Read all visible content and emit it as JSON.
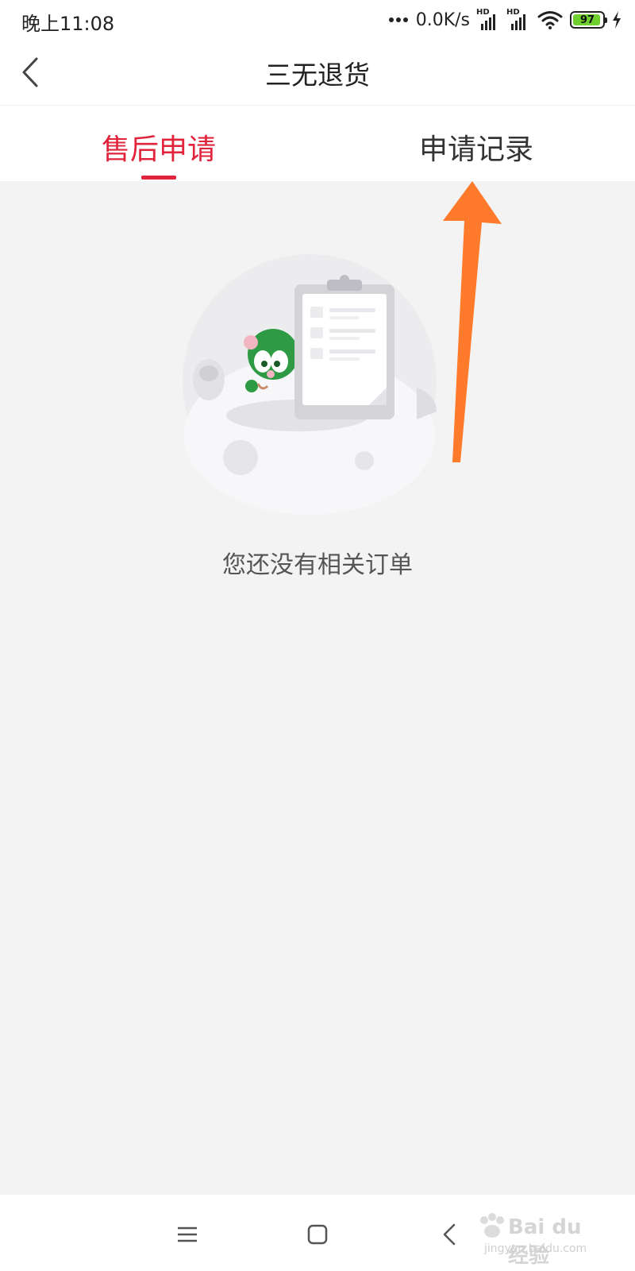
{
  "status_bar": {
    "time": "晚上11:08",
    "network_speed": "0.0K/s",
    "signal_label_1": "HD",
    "signal_label_2": "HD",
    "battery_level": "97"
  },
  "header": {
    "title": "三无退货"
  },
  "tabs": [
    {
      "label": "售后申请",
      "active": true
    },
    {
      "label": "申请记录",
      "active": false
    }
  ],
  "empty_state": {
    "message": "您还没有相关订单"
  },
  "annotation": {
    "arrow_color": "#ff7a2a"
  },
  "watermark": {
    "brand": "Bai du 经验",
    "site": "jingyan.baidu.com"
  },
  "colors": {
    "accent": "#e1233c",
    "background": "#f3f3f3"
  }
}
